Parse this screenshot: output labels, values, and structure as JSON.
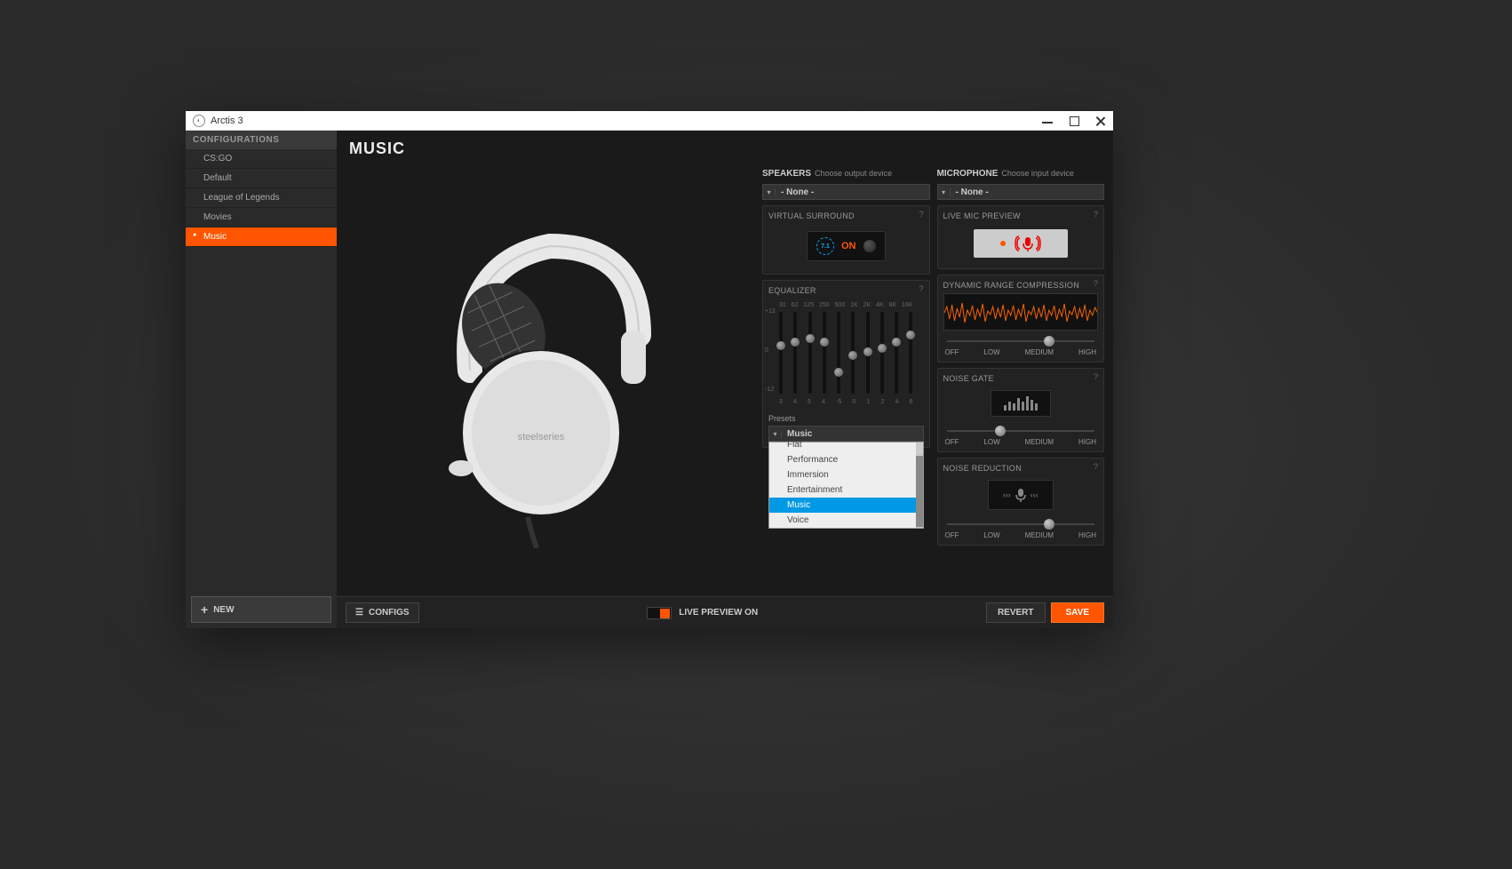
{
  "window": {
    "title": "Arctis 3"
  },
  "sidebar": {
    "header": "CONFIGURATIONS",
    "items": [
      {
        "label": "CS:GO"
      },
      {
        "label": "Default"
      },
      {
        "label": "League of Legends"
      },
      {
        "label": "Movies"
      },
      {
        "label": "Music",
        "active": true
      }
    ],
    "new_label": "NEW"
  },
  "main": {
    "title": "MUSIC"
  },
  "product": {
    "brand": "steelseries"
  },
  "speakers": {
    "title": "SPEAKERS",
    "subtitle": "Choose output device",
    "value": "- None -",
    "surround": {
      "title": "VIRTUAL SURROUND",
      "badge": "7.1",
      "state": "ON"
    },
    "equalizer": {
      "title": "EQUALIZER",
      "bands": [
        "31",
        "62",
        "125",
        "250",
        "500",
        "1K",
        "2K",
        "4K",
        "8K",
        "16K"
      ],
      "y_top": "+12",
      "y_mid": "0",
      "y_bot": "-12",
      "values": [
        3,
        4,
        5,
        4,
        -5,
        0,
        1,
        2,
        4,
        6
      ],
      "presets_label": "Presets",
      "preset_selected": "Music",
      "preset_options": [
        "Flat",
        "Performance",
        "Immersion",
        "Entertainment",
        "Music",
        "Voice"
      ]
    }
  },
  "mic": {
    "title": "MICROPHONE",
    "subtitle": "Choose input device",
    "value": "- None -",
    "preview": {
      "title": "LIVE MIC PREVIEW"
    },
    "drc": {
      "title": "DYNAMIC RANGE COMPRESSION",
      "labels": [
        "OFF",
        "LOW",
        "MEDIUM",
        "HIGH"
      ],
      "pos": 66
    },
    "gate": {
      "title": "NOISE GATE",
      "labels": [
        "OFF",
        "LOW",
        "MEDIUM",
        "HIGH"
      ],
      "pos": 33
    },
    "nr": {
      "title": "NOISE REDUCTION",
      "labels": [
        "OFF",
        "LOW",
        "MEDIUM",
        "HIGH"
      ],
      "pos": 66
    }
  },
  "footer": {
    "configs": "CONFIGS",
    "live_preview": "LIVE PREVIEW ON",
    "revert": "REVERT",
    "save": "SAVE"
  }
}
